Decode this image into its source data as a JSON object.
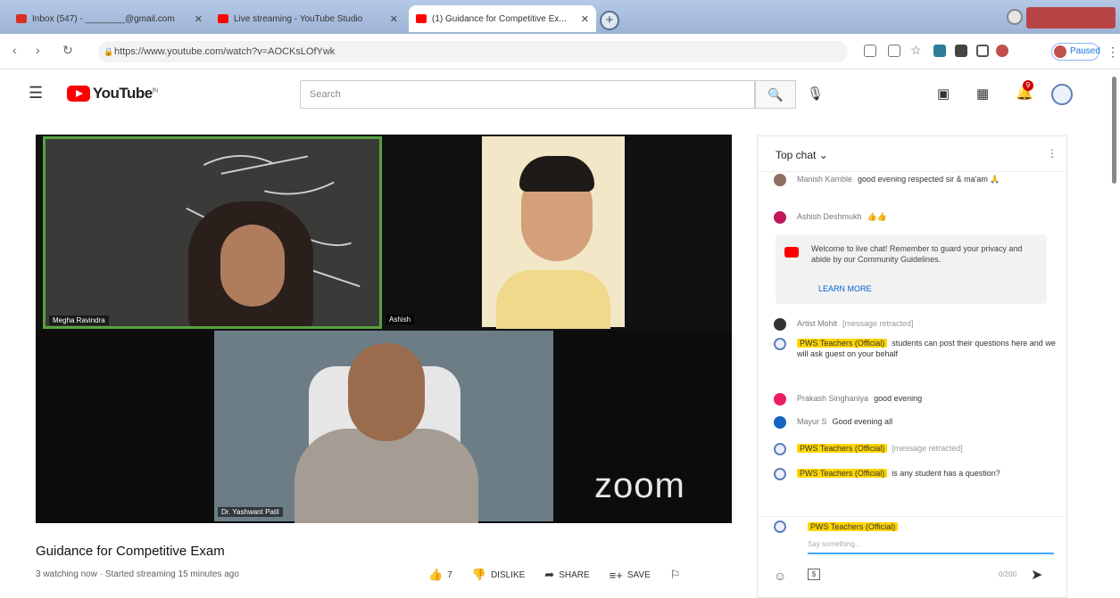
{
  "browser": {
    "tabs": [
      {
        "label": "Inbox (547) - ________@gmail.com",
        "active": false,
        "fav_color": "#d93025"
      },
      {
        "label": "Live streaming - YouTube Studio",
        "active": false,
        "fav_color": "#ff0000"
      },
      {
        "label": "(1) Guidance for Competitive Ex...",
        "active": true,
        "fav_color": "#ff0000"
      }
    ],
    "new_tab": "+",
    "url": "https://www.youtube.com/watch?v=AOCKsLOfYwk",
    "paused_label": "Paused"
  },
  "youtube": {
    "logo_text": "YouTube",
    "logo_sup": "IN",
    "search_placeholder": "Search",
    "notification_count": "9"
  },
  "video": {
    "participants": [
      "Megha Ravindra",
      "Ashish",
      "Dr. Yashwant Patil"
    ],
    "watermark": "zoom",
    "title": "Guidance for Competitive Exam",
    "meta": "3 watching now · Started streaming 15 minutes ago",
    "likes": "7",
    "dislike_label": "DISLIKE",
    "share_label": "SHARE",
    "save_label": "SAVE"
  },
  "chat": {
    "header": "Top chat",
    "messages": [
      {
        "author": "Manish Kamble",
        "text": "good evening respected sir & ma'am 🙏",
        "owner": false,
        "color": "#8d6e63"
      },
      {
        "author": "Ashish Deshmukh",
        "text": "👍👍",
        "owner": false,
        "color": "#c2185b"
      },
      {
        "author": "Artist Mohit",
        "text": "[message retracted]",
        "owner": false,
        "color": "#333333"
      },
      {
        "author": "PWS Teachers (Official)",
        "text": "students can post their questions here and we will ask guest on your behalf",
        "owner": true,
        "color": "#5f7fb8"
      },
      {
        "author": "Prakash Singhaniya",
        "text": "good evening",
        "owner": false,
        "color": "#e91e63"
      },
      {
        "author": "Mayur S",
        "text": "Good evening all",
        "owner": false,
        "color": "#1565c0"
      },
      {
        "author": "PWS Teachers (Official)",
        "text": "[message retracted]",
        "owner": true,
        "color": "#5f7fb8"
      },
      {
        "author": "PWS Teachers (Official)",
        "text": "is any student has a question?",
        "owner": true,
        "color": "#5f7fb8"
      }
    ],
    "notice_text": "Welcome to live chat! Remember to guard your privacy and abide by our Community Guidelines.",
    "notice_link": "LEARN MORE",
    "input_author": "PWS Teachers (Official)",
    "input_placeholder": "Say something...",
    "char_count": "0/200"
  }
}
